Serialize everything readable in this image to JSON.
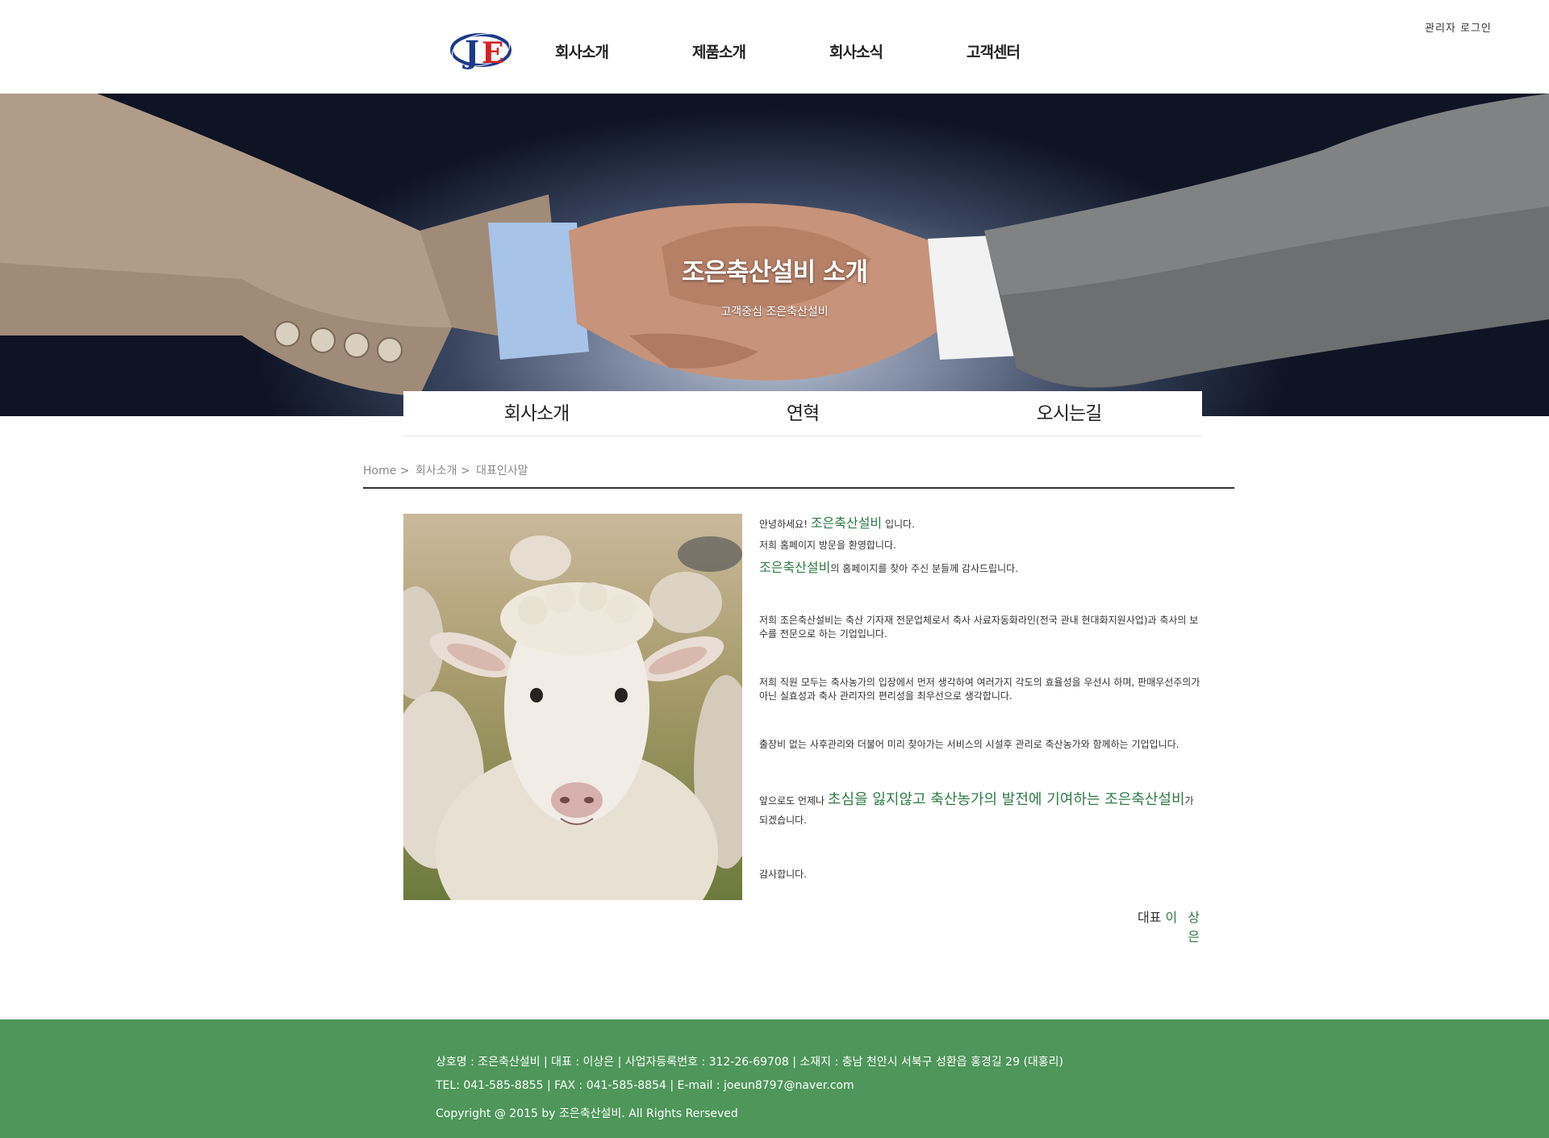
{
  "header": {
    "logo_text": "JE",
    "nav": [
      "회사소개",
      "제품소개",
      "회사소식",
      "고객센터"
    ],
    "admin_login": "관리자 로그인"
  },
  "hero": {
    "title": "조은축산설비 소개",
    "subtitle": "고객중심 조은축산설비"
  },
  "subtabs": [
    "회사소개",
    "연혁",
    "오시는길"
  ],
  "breadcrumb": [
    "Home",
    ">",
    "회사소개",
    ">",
    "대표인사말"
  ],
  "greeting": {
    "l1_a": "안녕하세요! ",
    "l1_b": "조은축산설비",
    "l1_c": " 입니다.",
    "l2": "저희 홈페이지 방문을 환영합니다.",
    "l3_a": "조은축산설비",
    "l3_b": "의 홈페이지를 찾아 주신 분들께 감사드립니다.",
    "p1": "저희 조은축산설비는 축산 기자재 전문업체로서 축사 사료자동화라인(전국 관내 현대화지원사업)과 축사의 보수를 전문으로 하는 기업입니다.",
    "p2": "저희 직원 모두는 축사농가의 입장에서 먼저 생각하여 여러가지 각도의 효율성을 우선시 하며, 판매우선주의가 아닌 실효성과 축사 관리자의 편리성을 최우선으로 생각합니다.",
    "p3": "출장비 없는 사후관리와 더불어 미리 찾아가는 서비스의 시설후 관리로 축산농가와 함께하는 기업입니다.",
    "p4_a": "앞으로도 언제나 ",
    "p4_b": "초심을 잃지않고 축산농가의 발전에 기여하는 조은축산설비",
    "p4_c": "가 되겠습니다.",
    "thanks": "감사합니다.",
    "sign_label": "대표 ",
    "sign_name": "이 상 은"
  },
  "footer": {
    "line1": "상호명 : 조은축산설비 | 대표 : 이상은 | 사업자등록번호 : 312-26-69708 | 소재지 : 충남 천안시 서북구 성환읍 홍경길 29 (대홍리)",
    "line2": "TEL: 041-585-8855 | FAX : 041-585-8854 | E-mail : joeun8797@naver.com",
    "line3": "Copyright @ 2015 by 조은축산설비. All Rights Rerseved"
  },
  "colors": {
    "accent_green": "#2f7a45",
    "footer_bg": "#4e965a"
  }
}
